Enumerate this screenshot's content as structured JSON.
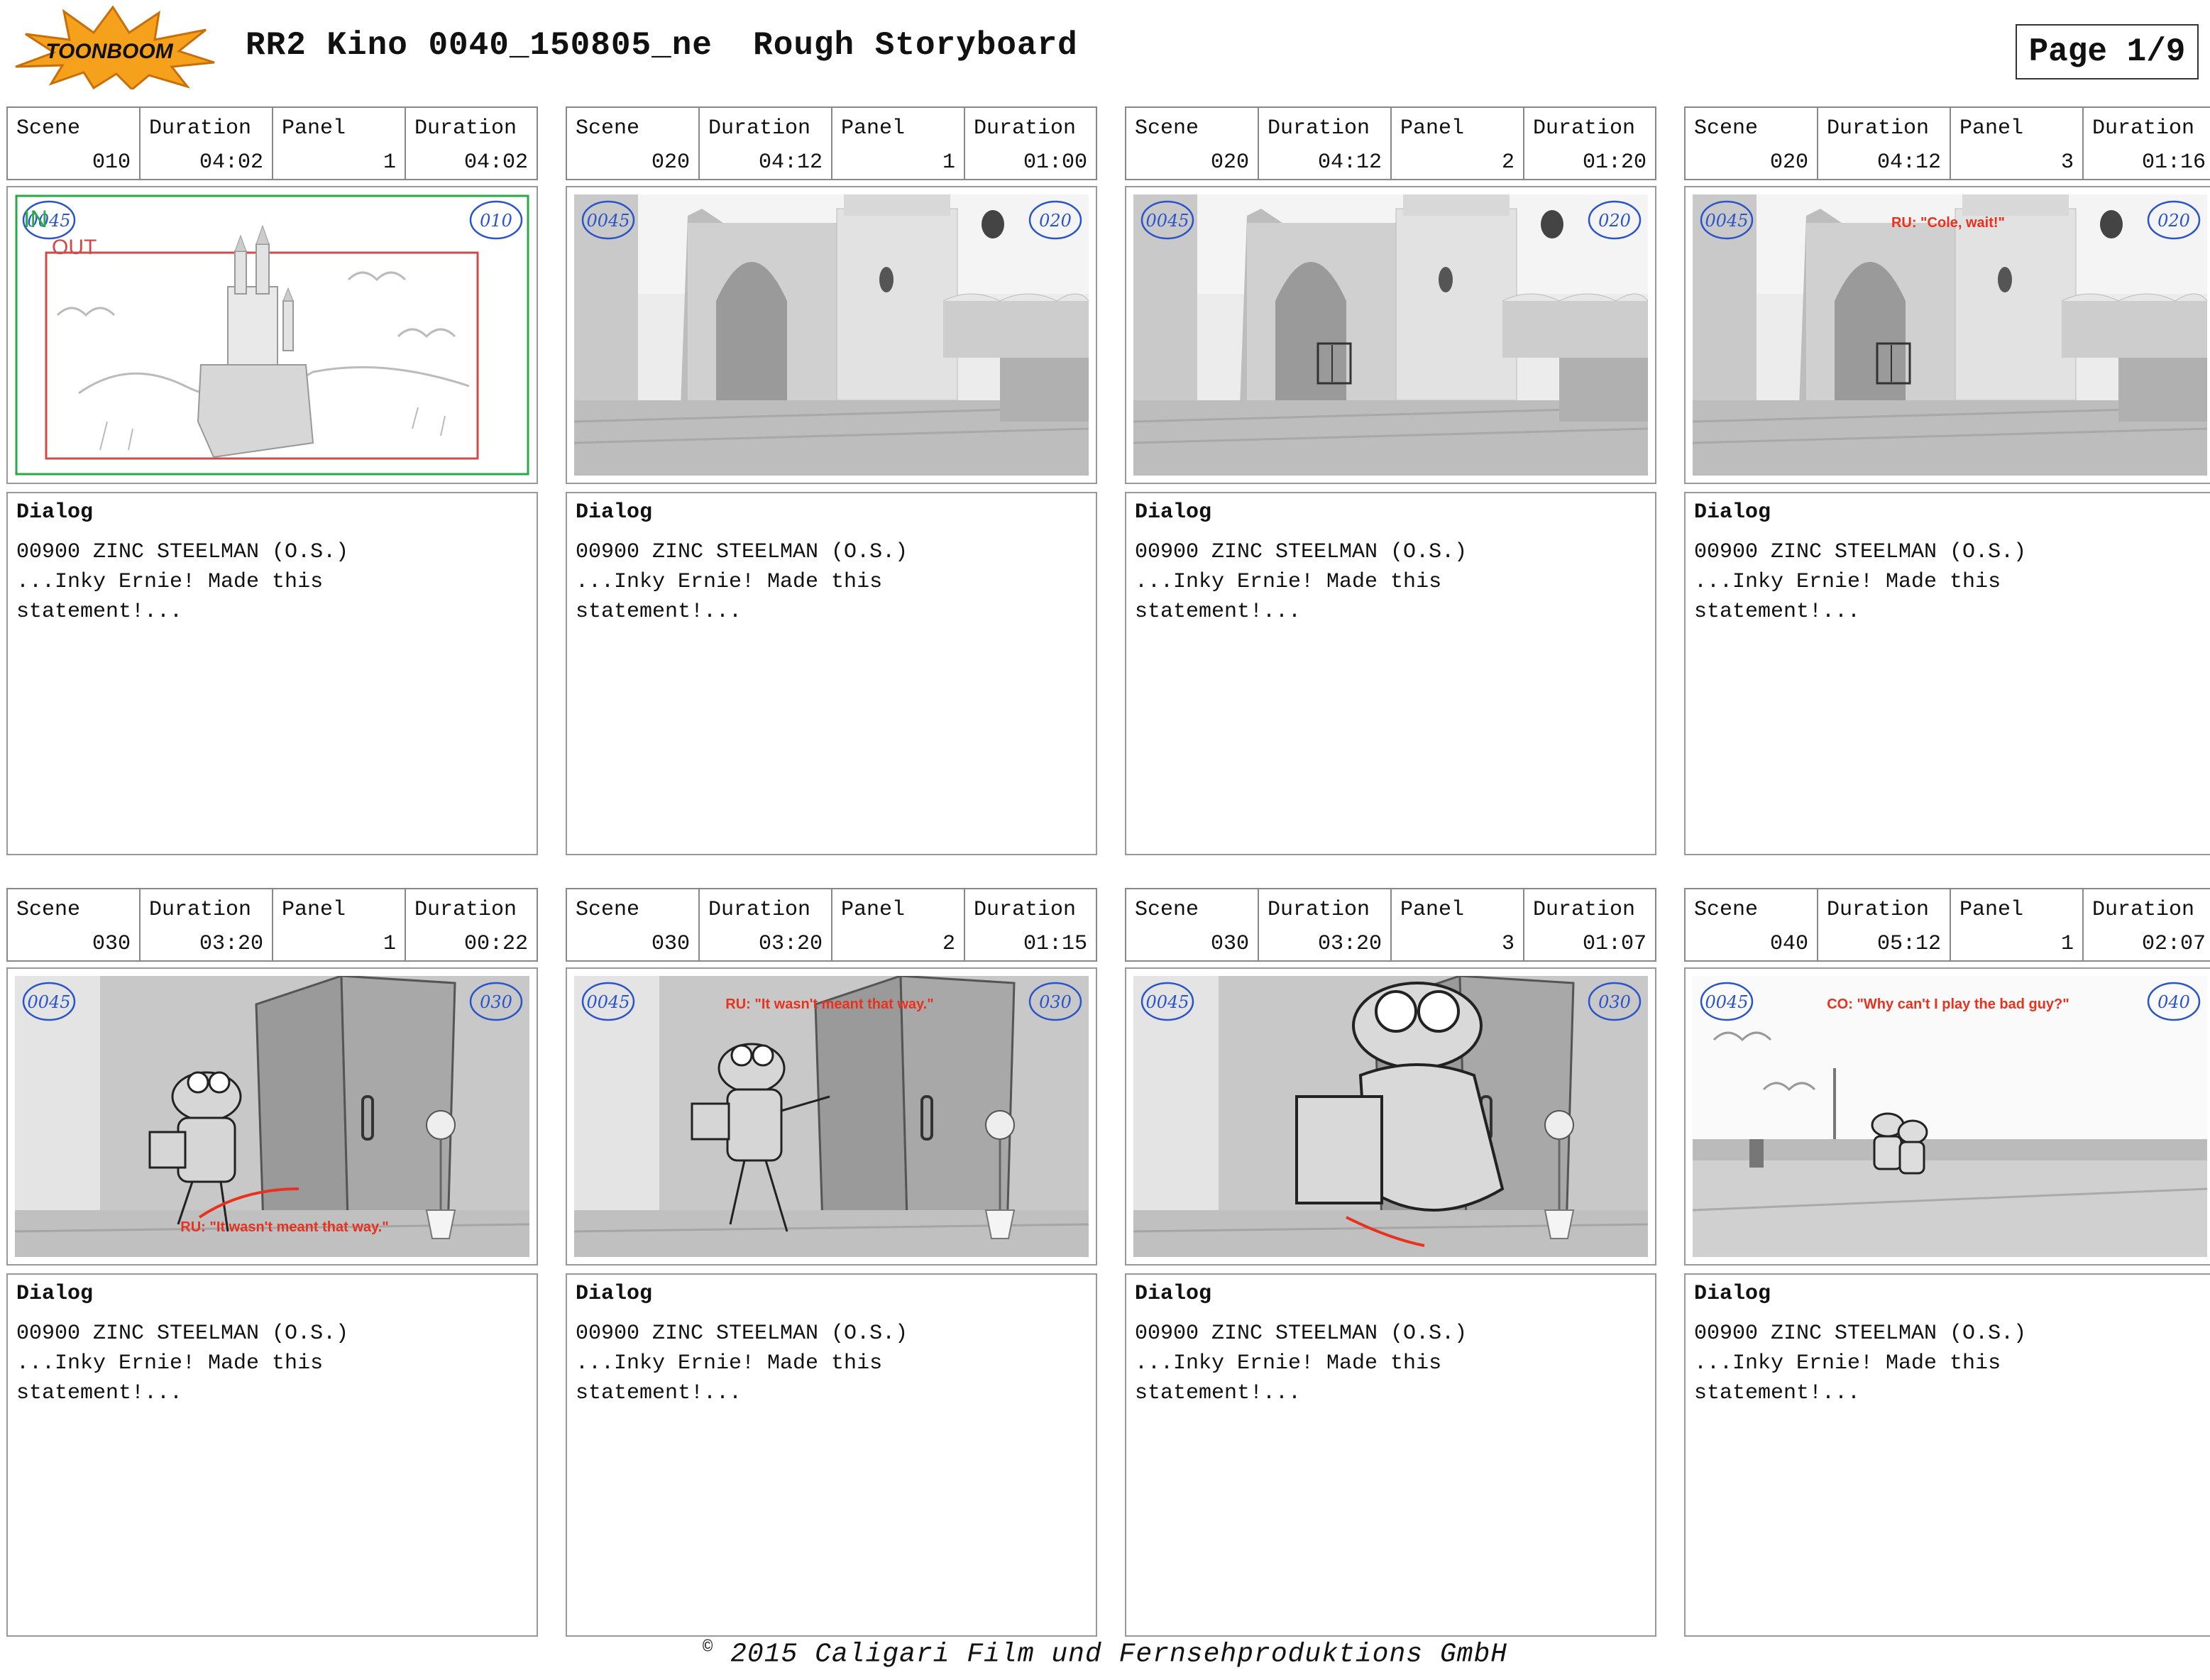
{
  "header": {
    "logo_text": "TOONBOOM",
    "title": "RR2 Kino 0040_150805_ne  Rough Storyboard",
    "page": "Page 1/9"
  },
  "labels": {
    "scene": "Scene",
    "duration": "Duration",
    "panel": "Panel",
    "dialog": "Dialog"
  },
  "panels": [
    {
      "scene": "010",
      "scene_duration": "04:02",
      "panel": "1",
      "panel_duration": "04:02",
      "tag": "0045",
      "scene_tag": "010",
      "annotation": "",
      "in_label": "IN",
      "out_label": "OUT",
      "dialog": "00900 ZINC STEELMAN (O.S.)\n...Inky Ernie! Made this\nstatement!..."
    },
    {
      "scene": "020",
      "scene_duration": "04:12",
      "panel": "1",
      "panel_duration": "01:00",
      "tag": "0045",
      "scene_tag": "020",
      "annotation": "",
      "dialog": "00900 ZINC STEELMAN (O.S.)\n...Inky Ernie! Made this\nstatement!..."
    },
    {
      "scene": "020",
      "scene_duration": "04:12",
      "panel": "2",
      "panel_duration": "01:20",
      "tag": "0045",
      "scene_tag": "020",
      "annotation": "",
      "dialog": "00900 ZINC STEELMAN (O.S.)\n...Inky Ernie! Made this\nstatement!..."
    },
    {
      "scene": "020",
      "scene_duration": "04:12",
      "panel": "3",
      "panel_duration": "01:16",
      "tag": "0045",
      "scene_tag": "020",
      "annotation": "RU: \"Cole, wait!\"",
      "dialog": "00900 ZINC STEELMAN (O.S.)\n...Inky Ernie! Made this\nstatement!..."
    },
    {
      "scene": "030",
      "scene_duration": "03:20",
      "panel": "1",
      "panel_duration": "00:22",
      "tag": "0045",
      "scene_tag": "030",
      "annotation": "RU: \"It wasn't meant that way.\"",
      "dialog": "00900 ZINC STEELMAN (O.S.)\n...Inky Ernie! Made this\nstatement!..."
    },
    {
      "scene": "030",
      "scene_duration": "03:20",
      "panel": "2",
      "panel_duration": "01:15",
      "tag": "0045",
      "scene_tag": "030",
      "annotation": "RU: \"It wasn't meant that way.\"",
      "dialog": "00900 ZINC STEELMAN (O.S.)\n...Inky Ernie! Made this\nstatement!..."
    },
    {
      "scene": "030",
      "scene_duration": "03:20",
      "panel": "3",
      "panel_duration": "01:07",
      "tag": "0045",
      "scene_tag": "030",
      "annotation": "",
      "dialog": "00900 ZINC STEELMAN (O.S.)\n...Inky Ernie! Made this\nstatement!..."
    },
    {
      "scene": "040",
      "scene_duration": "05:12",
      "panel": "1",
      "panel_duration": "02:07",
      "tag": "0045",
      "scene_tag": "040",
      "annotation": "CO: \"Why can't I play the bad guy?\"",
      "dialog": "00900 ZINC STEELMAN (O.S.)\n...Inky Ernie! Made this\nstatement!..."
    }
  ],
  "footer": {
    "copyright_symbol": "©",
    "text": "2015 Caligari Film und Fernsehproduktions GmbH"
  },
  "colors": {
    "annotation_red": "#e8321e",
    "tag_blue": "#2a55c8",
    "in_green": "#2aa84a",
    "frame_red": "#d44848"
  }
}
